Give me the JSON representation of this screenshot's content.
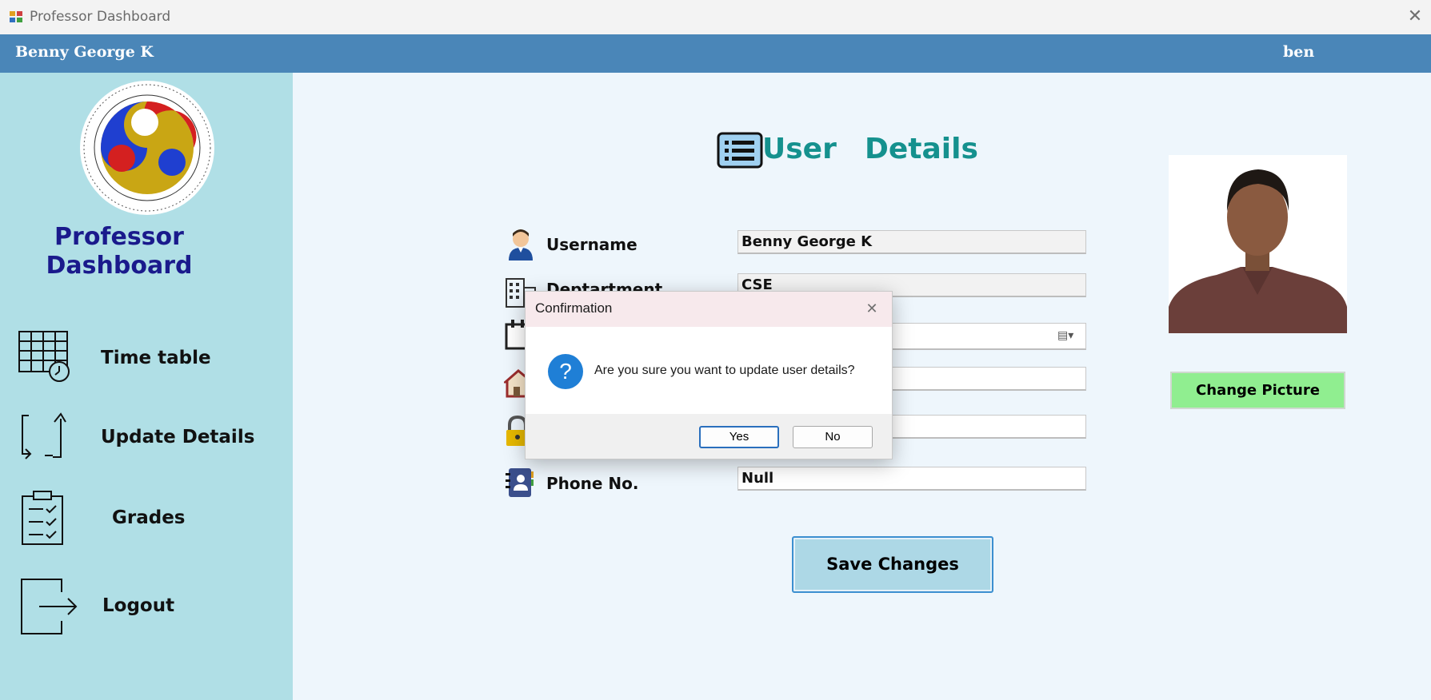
{
  "window": {
    "title": "Professor Dashboard"
  },
  "header": {
    "name": "Benny George K",
    "user": "ben"
  },
  "sidebar": {
    "brand_line1": "Professor",
    "brand_line2": "Dashboard",
    "items": [
      {
        "label": "Time table",
        "icon": "timetable-clock-icon"
      },
      {
        "label": "Update Details",
        "icon": "update-arrows-icon"
      },
      {
        "label": "Grades",
        "icon": "clipboard-checklist-icon"
      },
      {
        "label": "Logout",
        "icon": "logout-arrow-icon"
      }
    ]
  },
  "main": {
    "heading_word1": "User",
    "heading_word2": "Details",
    "fields": [
      {
        "label": "Username",
        "value": "Benny George K",
        "icon": "user-icon"
      },
      {
        "label": "Deptartment",
        "value": "CSE",
        "icon": "building-icon"
      },
      {
        "label": "",
        "value": "",
        "icon": "calendar-icon"
      },
      {
        "label": "",
        "value": "",
        "icon": "home-icon"
      },
      {
        "label": "",
        "value": "",
        "icon": "lock-icon"
      },
      {
        "label": "Phone No.",
        "value": "Null",
        "icon": "contact-book-icon"
      }
    ],
    "save_label": "Save Changes",
    "change_picture_label": "Change Picture"
  },
  "dialog": {
    "title": "Confirmation",
    "message": "Are you sure you want to update user details?",
    "yes_label": "Yes",
    "no_label": "No",
    "question_glyph": "?"
  },
  "colors": {
    "header": "#4a86b8",
    "sidebar": "#b0dfe6",
    "main_bg": "#eef6fc",
    "heading": "#15918e",
    "save_button": "#add8e6",
    "change_picture_button": "#90ee90"
  }
}
